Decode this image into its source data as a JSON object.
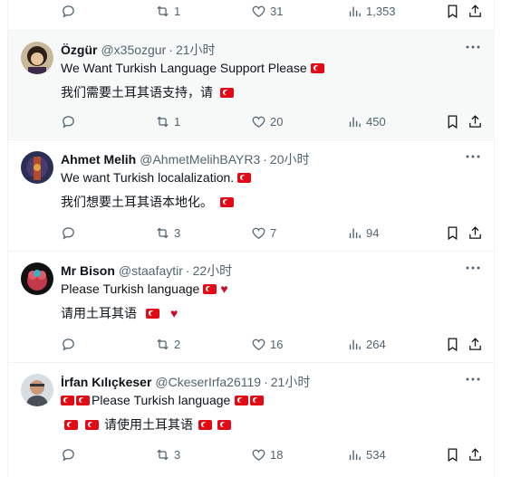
{
  "top_bar": {
    "reply": "",
    "retweet": "1",
    "like": "31",
    "views": "1,353"
  },
  "tweets": [
    {
      "name": "Özgür",
      "handle": "@x35ozgur",
      "time": "21小时",
      "line1": "We Want Turkish Language Support Please",
      "line2": "我们需要土耳其语支持，请",
      "retweet": "1",
      "like": "20",
      "views": "450"
    },
    {
      "name": "Ahmet Melih",
      "handle": "@AhmetMelihBAYR3",
      "time": "20小时",
      "line1": "We want Turkish localalization.",
      "line2": "我们想要土耳其语本地化。",
      "retweet": "3",
      "like": "7",
      "views": "94"
    },
    {
      "name": "Mr Bison",
      "handle": "@staafaytir",
      "time": "22小时",
      "line1": "Please Turkish language",
      "line2": "请用土耳其语",
      "retweet": "2",
      "like": "16",
      "views": "264"
    },
    {
      "name": "İrfan Kılıçkeser",
      "handle": "@CkeserIrfa26119",
      "time": "21小时",
      "line1": "Please Turkish language",
      "line2": "请使用土耳其语",
      "retweet": "3",
      "like": "18",
      "views": "534"
    }
  ],
  "icons": [
    "reply-icon",
    "retweet-icon",
    "like-icon",
    "views-icon",
    "bookmark-icon",
    "share-icon",
    "more-icon",
    "turkey-flag-icon",
    "heart-emoji-icon"
  ],
  "colors": {
    "text": "#0f1419",
    "secondary": "#536471",
    "flag": "#e30a17",
    "highlight_bg": "#f7f9f9"
  }
}
